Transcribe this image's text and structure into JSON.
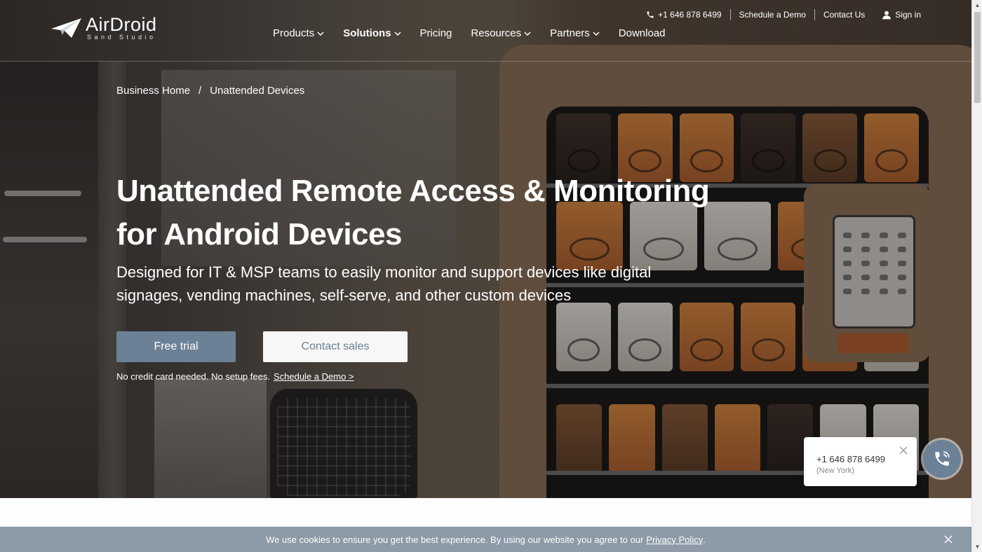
{
  "brand": {
    "name": "AirDroid",
    "sub": "Sand Studio"
  },
  "top_bar": {
    "phone": "+1 646 878 6499",
    "schedule_demo": "Schedule a Demo",
    "contact_us": "Contact Us",
    "sign_in": "Sign in"
  },
  "nav": {
    "items": [
      {
        "label": "Products",
        "dropdown": true
      },
      {
        "label": "Solutions",
        "dropdown": true
      },
      {
        "label": "Pricing",
        "dropdown": false
      },
      {
        "label": "Resources",
        "dropdown": true
      },
      {
        "label": "Partners",
        "dropdown": true
      },
      {
        "label": "Download",
        "dropdown": false
      }
    ]
  },
  "breadcrumb": {
    "home": "Business Home",
    "separator": "/",
    "current": "Unattended Devices"
  },
  "hero": {
    "title": "Unattended Remote Access & Monitoring for Android Devices",
    "subtitle": "Designed for IT & MSP teams to easily monitor and support devices like digital signages, vending machines, self-serve, and other custom devices",
    "primary_button": "Free trial",
    "secondary_button": "Contact sales",
    "note": "No credit card needed. No setup fees.",
    "note_link": "Schedule a Demo >"
  },
  "call_widget": {
    "phone": "+1 646 878 6499",
    "city": "(New York)"
  },
  "cookie_banner": {
    "text": "We use cookies to ensure you get the best experience. By using our website you agree to our",
    "link": "Privacy Policy",
    "suffix": "."
  },
  "colors": {
    "accent": "#6d8196",
    "cookie_bg": "#8d9aa7"
  },
  "icons": {
    "phone": "phone-icon",
    "user": "user-icon",
    "chevron": "chevron-down-icon",
    "close": "close-icon",
    "call": "phone-call-icon"
  }
}
